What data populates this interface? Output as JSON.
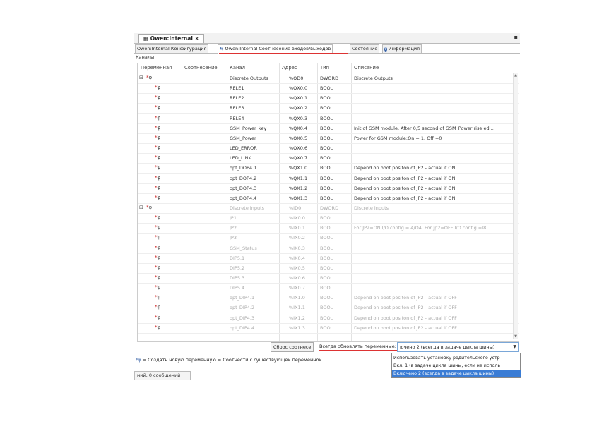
{
  "document_tab": {
    "title": "Owen:Internal",
    "close": "×",
    "pin": "▪"
  },
  "tabs": [
    {
      "label": "Owen:Internal Конфигурация"
    },
    {
      "icon": "⇆",
      "label": "Owen:Internal Соотнесение входов/выходов"
    },
    {
      "label": "Состояние"
    },
    {
      "icon": "i",
      "label": "Информация"
    }
  ],
  "section_label": "Каналы",
  "columns": {
    "variable": "Переменная",
    "mapping": "Соотнесение",
    "channel": "Канал",
    "address": "Адрес",
    "type": "Тип",
    "description": "Описание"
  },
  "rows": [
    {
      "group": true,
      "gray": false,
      "channel": "Discrete Outputs",
      "address": "%QD0",
      "type": "DWORD",
      "description": "Discrete Outputs"
    },
    {
      "group": false,
      "gray": false,
      "channel": "RELE1",
      "address": "%QX0.0",
      "type": "BOOL",
      "description": ""
    },
    {
      "group": false,
      "gray": false,
      "channel": "RELE2",
      "address": "%QX0.1",
      "type": "BOOL",
      "description": ""
    },
    {
      "group": false,
      "gray": false,
      "channel": "RELE3",
      "address": "%QX0.2",
      "type": "BOOL",
      "description": ""
    },
    {
      "group": false,
      "gray": false,
      "channel": "RELE4",
      "address": "%QX0.3",
      "type": "BOOL",
      "description": ""
    },
    {
      "group": false,
      "gray": false,
      "channel": "GSM_Power_key",
      "address": "%QX0.4",
      "type": "BOOL",
      "description": "Init of GSM module. After 0,5 second of GSM_Power rise ed..."
    },
    {
      "group": false,
      "gray": false,
      "channel": "GSM_Power",
      "address": "%QX0.5",
      "type": "BOOL",
      "description": "Power for GSM module:On = 1, Off =0"
    },
    {
      "group": false,
      "gray": false,
      "channel": "LED_ERROR",
      "address": "%QX0.6",
      "type": "BOOL",
      "description": ""
    },
    {
      "group": false,
      "gray": false,
      "channel": "LED_LINK",
      "address": "%QX0.7",
      "type": "BOOL",
      "description": ""
    },
    {
      "group": false,
      "gray": false,
      "channel": "opt_DOP4.1",
      "address": "%QX1.0",
      "type": "BOOL",
      "description": "Depend on boot positon of JP2 - actual if ON"
    },
    {
      "group": false,
      "gray": false,
      "channel": "opt_DOP4.2",
      "address": "%QX1.1",
      "type": "BOOL",
      "description": "Depend on boot positon of JP2 - actual if ON"
    },
    {
      "group": false,
      "gray": false,
      "channel": "opt_DOP4.3",
      "address": "%QX1.2",
      "type": "BOOL",
      "description": "Depend on boot positon of JP2 - actual if ON"
    },
    {
      "group": false,
      "gray": false,
      "channel": "opt_DOP4.4",
      "address": "%QX1.3",
      "type": "BOOL",
      "description": "Depend on boot positon of JP2 - actual if ON"
    },
    {
      "group": true,
      "gray": true,
      "channel": "Discrete inputs",
      "address": "%ID0",
      "type": "DWORD",
      "description": "Discrete inputs"
    },
    {
      "group": false,
      "gray": true,
      "channel": "JP1",
      "address": "%IX0.0",
      "type": "BOOL",
      "description": ""
    },
    {
      "group": false,
      "gray": true,
      "channel": "JP2",
      "address": "%IX0.1",
      "type": "BOOL",
      "description": "For JP2=ON I/O config =I4/O4. For Jp2=OFF I/O config =I8"
    },
    {
      "group": false,
      "gray": true,
      "channel": "JP3",
      "address": "%IX0.2",
      "type": "BOOL",
      "description": ""
    },
    {
      "group": false,
      "gray": true,
      "channel": "GSM_Status",
      "address": "%IX0.3",
      "type": "BOOL",
      "description": ""
    },
    {
      "group": false,
      "gray": true,
      "channel": "DIP5.1",
      "address": "%IX0.4",
      "type": "BOOL",
      "description": ""
    },
    {
      "group": false,
      "gray": true,
      "channel": "DIP5.2",
      "address": "%IX0.5",
      "type": "BOOL",
      "description": ""
    },
    {
      "group": false,
      "gray": true,
      "channel": "DIP5.3",
      "address": "%IX0.6",
      "type": "BOOL",
      "description": ""
    },
    {
      "group": false,
      "gray": true,
      "channel": "DIP5.4",
      "address": "%IX0.7",
      "type": "BOOL",
      "description": ""
    },
    {
      "group": false,
      "gray": true,
      "channel": "opt_DIP4.1",
      "address": "%IX1.0",
      "type": "BOOL",
      "description": "Depend on boot positon of JP2 - actual if OFF"
    },
    {
      "group": false,
      "gray": true,
      "channel": "opt_DIP4.2",
      "address": "%IX1.1",
      "type": "BOOL",
      "description": "Depend on boot positon of JP2 - actual if OFF"
    },
    {
      "group": false,
      "gray": true,
      "channel": "opt_DIP4.3",
      "address": "%IX1.2",
      "type": "BOOL",
      "description": "Depend on boot positon of JP2 - actual if OFF"
    },
    {
      "group": false,
      "gray": true,
      "channel": "opt_DIP4.4",
      "address": "%IX1.3",
      "type": "BOOL",
      "description": "Depend on boot positon of JP2 - actual if OFF"
    }
  ],
  "bottom": {
    "reset_button": "Сброс соотнесе",
    "always_update_label": "Всегда обновлять переменные:",
    "combo_value": "ючено 2 (всегда в задаче цикла шины)"
  },
  "dropdown_options": [
    "Использовать установку родительского устр",
    "Вкл. 1 (в задаче цикла шины, если не исполь",
    "Включено 2 (всегда в задаче цикла шины)"
  ],
  "legend_text": "= Создать новую переменную = Соотнести с существующей переменной",
  "legend_icons": {
    "new": "*φ",
    "existing": "*φ"
  },
  "status_text": "ний, 0 сообщений",
  "colors": {
    "accent_red": "#d33333",
    "selection_blue": "#3a7cd5",
    "icon_blue": "#335fa6"
  }
}
